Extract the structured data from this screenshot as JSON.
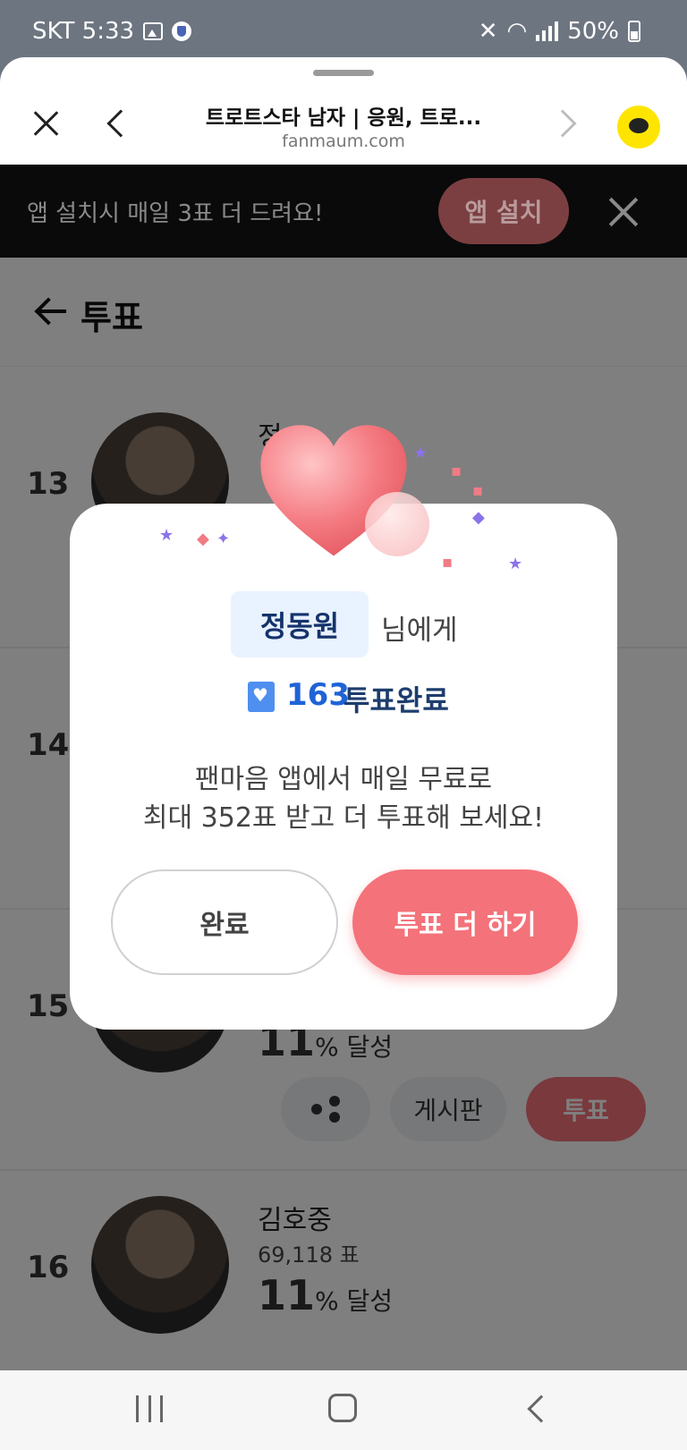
{
  "status_bar": {
    "carrier_time": "SKT 5:33",
    "battery": "50%"
  },
  "browser": {
    "title": "트로트스타 남자 | 응원, 트로...",
    "url": "fanmaum.com"
  },
  "banner": {
    "text": "앱 설치시 매일 3표 더 드려요!",
    "install_label": "앱 설치"
  },
  "page": {
    "title": "투표",
    "rows": [
      {
        "rank": "13",
        "name": "정..."
      },
      {
        "rank": "14"
      },
      {
        "rank": "15",
        "percent": "11",
        "percent_suffix": "% 달성",
        "board_label": "게시판",
        "vote_label": "투표"
      },
      {
        "rank": "16",
        "name": "김호중",
        "votes": "69,118 표",
        "percent": "11",
        "percent_suffix": "% 달성"
      }
    ]
  },
  "modal": {
    "recipient_name": "정동원",
    "recipient_suffix": "님에게",
    "vote_count": "163",
    "vote_done_label": "투표완료",
    "message_line1": "팬마음 앱에서 매일 무료로",
    "message_line2": "최대 352표 받고 더 투표해 보세요!",
    "done_button": "완료",
    "more_button": "투표 더 하기"
  },
  "colors": {
    "accent": "#f4727a",
    "blue": "#1f63d6",
    "chip_bg": "#e9f2ff"
  }
}
